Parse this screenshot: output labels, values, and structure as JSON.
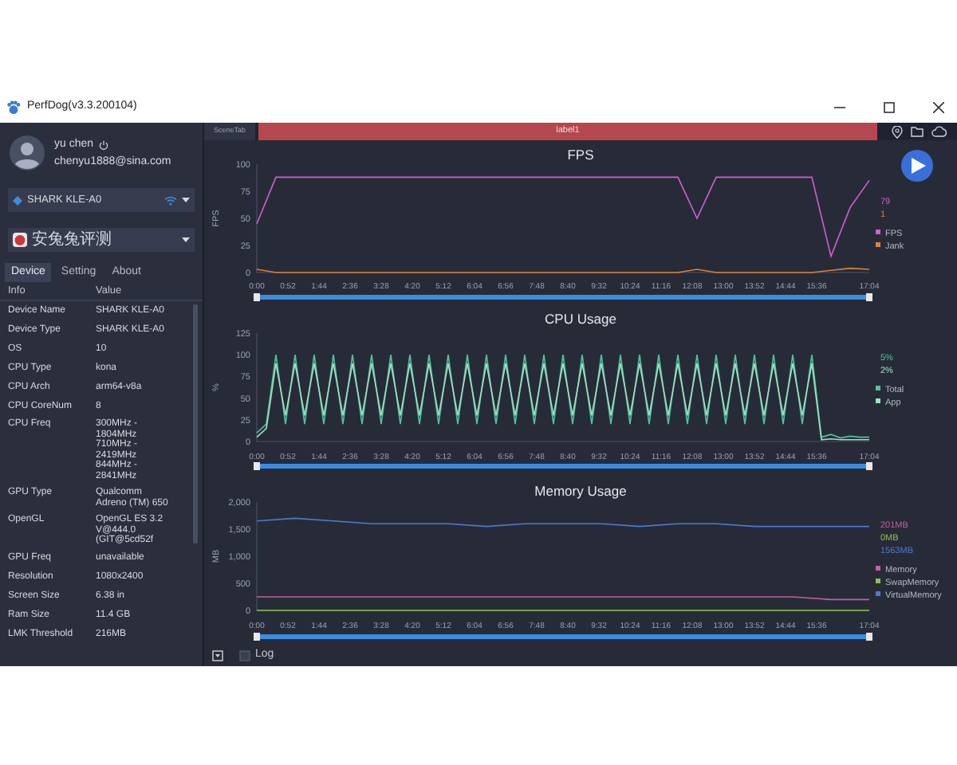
{
  "window": {
    "title": "PerfDog(v3.3.200104)"
  },
  "user": {
    "name": "yu chen",
    "email": "chenyu1888@sina.com"
  },
  "device_dropdown": {
    "value": "SHARK KLE-A0"
  },
  "app_dropdown": {
    "value": "安兔兔评测"
  },
  "tabs": [
    {
      "label": "Device",
      "selected": true
    },
    {
      "label": "Setting",
      "selected": false
    },
    {
      "label": "About",
      "selected": false
    }
  ],
  "info_table": {
    "columns": [
      "Info",
      "Value"
    ],
    "rows": [
      [
        "Device Name",
        "SHARK KLE-A0"
      ],
      [
        "Device Type",
        "SHARK KLE-A0"
      ],
      [
        "OS",
        "10"
      ],
      [
        "CPU Type",
        "kona"
      ],
      [
        "CPU Arch",
        "arm64-v8a"
      ],
      [
        "CPU CoreNum",
        "8"
      ],
      [
        "CPU Freq",
        "300MHz -\n1804MHz\n710MHz -\n2419MHz\n844MHz -\n2841MHz"
      ],
      [
        "GPU Type",
        "Qualcomm\nAdreno (TM) 650"
      ],
      [
        "OpenGL",
        "OpenGL ES 3.2\nV@444.0\n(GIT@5cd52f"
      ],
      [
        "GPU Freq",
        "unavailable"
      ],
      [
        "Resolution",
        "1080x2400"
      ],
      [
        "Screen Size",
        "6.38 in"
      ],
      [
        "Ram Size",
        "11.4 GB"
      ],
      [
        "LMK Threshold",
        "216MB"
      ]
    ]
  },
  "scene_tab": {
    "label": "SceneTab"
  },
  "label_bar": {
    "label": "label1"
  },
  "charts": [
    {
      "readings": [
        "79",
        "1"
      ],
      "chart_data": {
        "type": "line",
        "legend": true,
        "title": "FPS",
        "ylabel": "FPS",
        "xlim": [
          0,
          1024
        ],
        "ylim": [
          0,
          100
        ],
        "x": [
          0,
          32,
          64,
          96,
          128,
          160,
          192,
          224,
          256,
          288,
          320,
          352,
          384,
          416,
          448,
          480,
          512,
          544,
          576,
          608,
          640,
          672,
          704,
          736,
          768,
          800,
          832,
          864,
          896,
          928,
          960,
          992,
          1024
        ],
        "series": [
          {
            "name": "FPS",
            "color": "#d05fd0",
            "values": [
              45,
              88,
              88,
              88,
              88,
              88,
              88,
              88,
              88,
              88,
              88,
              88,
              88,
              88,
              88,
              88,
              88,
              88,
              88,
              88,
              88,
              88,
              88,
              50,
              88,
              88,
              88,
              88,
              88,
              88,
              15,
              60,
              85
            ]
          },
          {
            "name": "Jank",
            "color": "#e0803a",
            "values": [
              3,
              0,
              0,
              0,
              0,
              0,
              0,
              0,
              0,
              0,
              0,
              0,
              0,
              0,
              0,
              0,
              0,
              0,
              0,
              0,
              0,
              0,
              0,
              3,
              0,
              0,
              0,
              0,
              0,
              0,
              2,
              4,
              3
            ]
          }
        ],
        "xticks": [
          {
            "value": 0,
            "label": "0:00"
          },
          {
            "value": 52,
            "label": "0:52"
          },
          {
            "value": 104,
            "label": "1:44"
          },
          {
            "value": 156,
            "label": "2:36"
          },
          {
            "value": 208,
            "label": "3:28"
          },
          {
            "value": 260,
            "label": "4:20"
          },
          {
            "value": 312,
            "label": "5:12"
          },
          {
            "value": 364,
            "label": "6:04"
          },
          {
            "value": 416,
            "label": "6:56"
          },
          {
            "value": 468,
            "label": "7:48"
          },
          {
            "value": 520,
            "label": "8:40"
          },
          {
            "value": 572,
            "label": "9:32"
          },
          {
            "value": 624,
            "label": "10:24"
          },
          {
            "value": 676,
            "label": "11:16"
          },
          {
            "value": 728,
            "label": "12:08"
          },
          {
            "value": 780,
            "label": "13:00"
          },
          {
            "value": 832,
            "label": "13:52"
          },
          {
            "value": 884,
            "label": "14:44"
          },
          {
            "value": 936,
            "label": "15:36"
          },
          {
            "value": 1024,
            "label": "17:04"
          }
        ],
        "yticks": [
          0,
          25,
          50,
          75,
          100
        ]
      }
    },
    {
      "readings": [
        "5%",
        "2%"
      ],
      "chart_data": {
        "type": "line",
        "legend": true,
        "title": "CPU Usage",
        "ylabel": "%",
        "xlim": [
          0,
          1024
        ],
        "ylim": [
          0,
          125
        ],
        "x": [
          0,
          16,
          32,
          48,
          64,
          80,
          96,
          112,
          128,
          144,
          160,
          176,
          192,
          208,
          224,
          240,
          256,
          272,
          288,
          304,
          320,
          336,
          352,
          368,
          384,
          400,
          416,
          432,
          448,
          464,
          480,
          496,
          512,
          528,
          544,
          560,
          576,
          592,
          608,
          624,
          640,
          656,
          672,
          688,
          704,
          720,
          736,
          752,
          768,
          784,
          800,
          816,
          832,
          848,
          864,
          880,
          896,
          912,
          928,
          944,
          960,
          976,
          992,
          1008,
          1024
        ],
        "series": [
          {
            "name": "Total",
            "color": "#4fc3a1",
            "values": [
              10,
              20,
              100,
              20,
              100,
              20,
              100,
              20,
              100,
              20,
              100,
              20,
              100,
              20,
              100,
              20,
              100,
              20,
              100,
              20,
              100,
              20,
              100,
              20,
              100,
              20,
              100,
              20,
              100,
              20,
              100,
              20,
              100,
              20,
              100,
              20,
              100,
              20,
              100,
              20,
              100,
              20,
              100,
              20,
              100,
              20,
              100,
              20,
              100,
              20,
              100,
              20,
              100,
              20,
              100,
              20,
              100,
              20,
              100,
              5,
              8,
              4,
              6,
              5,
              5
            ]
          },
          {
            "name": "App",
            "color": "#9fe0c0",
            "values": [
              5,
              15,
              90,
              30,
              90,
              30,
              90,
              30,
              90,
              30,
              90,
              30,
              90,
              30,
              90,
              30,
              90,
              30,
              90,
              30,
              90,
              30,
              90,
              30,
              90,
              30,
              90,
              30,
              90,
              30,
              90,
              30,
              90,
              30,
              90,
              30,
              90,
              30,
              90,
              30,
              90,
              30,
              90,
              30,
              90,
              30,
              90,
              30,
              90,
              30,
              90,
              30,
              90,
              30,
              90,
              30,
              90,
              30,
              90,
              2,
              3,
              2,
              2,
              2,
              2
            ]
          }
        ],
        "xticks": [
          {
            "value": 0,
            "label": "0:00"
          },
          {
            "value": 52,
            "label": "0:52"
          },
          {
            "value": 104,
            "label": "1:44"
          },
          {
            "value": 156,
            "label": "2:36"
          },
          {
            "value": 208,
            "label": "3:28"
          },
          {
            "value": 260,
            "label": "4:20"
          },
          {
            "value": 312,
            "label": "5:12"
          },
          {
            "value": 364,
            "label": "6:04"
          },
          {
            "value": 416,
            "label": "6:56"
          },
          {
            "value": 468,
            "label": "7:48"
          },
          {
            "value": 520,
            "label": "8:40"
          },
          {
            "value": 572,
            "label": "9:32"
          },
          {
            "value": 624,
            "label": "10:24"
          },
          {
            "value": 676,
            "label": "11:16"
          },
          {
            "value": 728,
            "label": "12:08"
          },
          {
            "value": 780,
            "label": "13:00"
          },
          {
            "value": 832,
            "label": "13:52"
          },
          {
            "value": 884,
            "label": "14:44"
          },
          {
            "value": 936,
            "label": "15:36"
          },
          {
            "value": 1024,
            "label": "17:04"
          }
        ],
        "yticks": [
          0,
          25,
          50,
          75,
          100,
          125
        ]
      }
    },
    {
      "readings": [
        "201MB",
        "0MB",
        "1563MB"
      ],
      "chart_data": {
        "type": "line",
        "legend": true,
        "title": "Memory Usage",
        "ylabel": "MB",
        "xlim": [
          0,
          1024
        ],
        "ylim": [
          0,
          2000
        ],
        "x": [
          0,
          64,
          128,
          192,
          256,
          320,
          384,
          448,
          512,
          576,
          640,
          704,
          768,
          832,
          896,
          960,
          1024
        ],
        "series": [
          {
            "name": "Memory",
            "color": "#c45fa0",
            "values": [
              250,
              250,
              250,
              250,
              250,
              250,
              250,
              250,
              250,
              250,
              250,
              250,
              250,
              250,
              250,
              200,
              200
            ]
          },
          {
            "name": "SwapMemory",
            "color": "#8bc34a",
            "values": [
              0,
              0,
              0,
              0,
              0,
              0,
              0,
              0,
              0,
              0,
              0,
              0,
              0,
              0,
              0,
              0,
              0
            ]
          },
          {
            "name": "VirtualMemory",
            "color": "#4a7bd0",
            "values": [
              1650,
              1700,
              1650,
              1600,
              1600,
              1600,
              1550,
              1600,
              1600,
              1600,
              1550,
              1600,
              1600,
              1550,
              1550,
              1550,
              1550
            ]
          }
        ],
        "xticks": [
          {
            "value": 0,
            "label": "0:00"
          },
          {
            "value": 52,
            "label": "0:52"
          },
          {
            "value": 104,
            "label": "1:44"
          },
          {
            "value": 156,
            "label": "2:36"
          },
          {
            "value": 208,
            "label": "3:28"
          },
          {
            "value": 260,
            "label": "4:20"
          },
          {
            "value": 312,
            "label": "5:12"
          },
          {
            "value": 364,
            "label": "6:04"
          },
          {
            "value": 416,
            "label": "6:56"
          },
          {
            "value": 468,
            "label": "7:48"
          },
          {
            "value": 520,
            "label": "8:40"
          },
          {
            "value": 572,
            "label": "9:32"
          },
          {
            "value": 624,
            "label": "10:24"
          },
          {
            "value": 676,
            "label": "11:16"
          },
          {
            "value": 728,
            "label": "12:08"
          },
          {
            "value": 780,
            "label": "13:00"
          },
          {
            "value": 832,
            "label": "13:52"
          },
          {
            "value": 884,
            "label": "14:44"
          },
          {
            "value": 936,
            "label": "15:36"
          },
          {
            "value": 1024,
            "label": "17:04"
          }
        ],
        "yticks": [
          {
            "value": 0,
            "label": "0"
          },
          {
            "value": 500,
            "label": "500"
          },
          {
            "value": 1000,
            "label": "1,000"
          },
          {
            "value": 1500,
            "label": "1,500"
          },
          {
            "value": 2000,
            "label": "2,000"
          }
        ]
      }
    }
  ],
  "log": {
    "label": "Log",
    "checked": false
  }
}
